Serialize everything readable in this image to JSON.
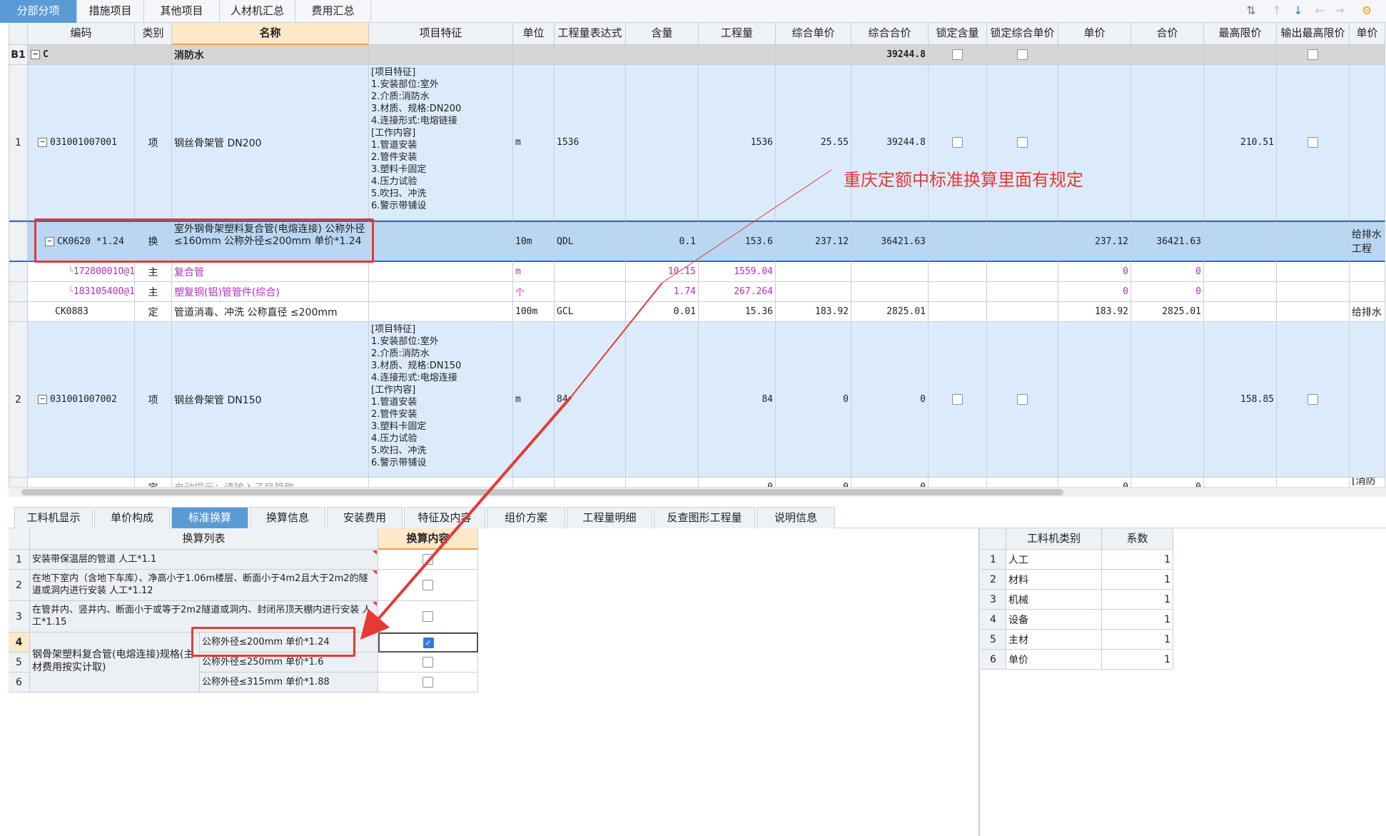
{
  "top_tabs": [
    "分部分项",
    "措施项目",
    "其他项目",
    "人材机汇总",
    "费用汇总"
  ],
  "toolbar_icons": [
    "sort-icon",
    "arrow-up-icon",
    "arrow-down-icon",
    "arrow-left-icon",
    "arrow-right-icon",
    "settings-icon"
  ],
  "columns": [
    "编码",
    "类别",
    "名称",
    "项目特征",
    "单位",
    "工程量表达式",
    "含量",
    "工程量",
    "综合单价",
    "综合合价",
    "锁定含量",
    "锁定综合单价",
    "单价",
    "合价",
    "最高限价",
    "输出最高限价",
    "单价构"
  ],
  "rows": [
    {
      "idx": "B1",
      "code": "C",
      "type": "",
      "name": "消防水",
      "feature": "",
      "unit": "",
      "expr": "",
      "content": "",
      "qty": "",
      "uprice": "",
      "total": "39244.8",
      "lock_content": true,
      "lock_uprice": true,
      "price": "",
      "sum": "",
      "max_price": "",
      "out_max": true,
      "price_comp": ""
    },
    {
      "idx": "1",
      "code": "031001007001",
      "type": "项",
      "name": "钢丝骨架管 DN200",
      "feature": "[项目特征]\n1.安装部位:室外\n2.介质:消防水\n3.材质、规格:DN200\n4.连接形式:电熔链接\n[工作内容]\n1.管道安装\n2.管件安装\n3.塑料卡固定\n4.压力试验\n5.吹扫、冲洗\n6.警示带铺设",
      "unit": "m",
      "expr": "1536",
      "content": "",
      "qty": "1536",
      "uprice": "25.55",
      "total": "39244.8",
      "lock_content": true,
      "lock_uprice": true,
      "price": "",
      "sum": "",
      "max_price": "210.51",
      "out_max": true,
      "price_comp": ""
    },
    {
      "idx": "",
      "code": "CK0620 *1.24",
      "type": "换",
      "name": "室外钢骨架塑料复合管(电熔连接) 公称外径 ≤160mm 公称外径≤200mm 单价*1.24",
      "feature": "",
      "unit": "10m",
      "expr": "QDL",
      "content": "0.1",
      "qty": "153.6",
      "uprice": "237.12",
      "total": "36421.63",
      "lock_content": false,
      "lock_uprice": false,
      "price": "237.12",
      "sum": "36421.63",
      "max_price": "",
      "out_max": false,
      "price_comp": "给排水工程"
    },
    {
      "idx": "",
      "code": "17280001O@1",
      "type": "主",
      "name": "复合管",
      "feature": "",
      "unit": "m",
      "expr": "",
      "content": "10.15",
      "qty": "1559.04",
      "uprice": "",
      "total": "",
      "lock_content": false,
      "lock_uprice": false,
      "price": "0",
      "sum": "0",
      "max_price": "",
      "out_max": false,
      "price_comp": ""
    },
    {
      "idx": "",
      "code": "18310540O@1",
      "type": "主",
      "name": "塑复铜(铝)管管件(综合)",
      "feature": "",
      "unit": "个",
      "expr": "",
      "content": "1.74",
      "qty": "267.264",
      "uprice": "",
      "total": "",
      "lock_content": false,
      "lock_uprice": false,
      "price": "0",
      "sum": "0",
      "max_price": "",
      "out_max": false,
      "price_comp": ""
    },
    {
      "idx": "",
      "code": "CK0883",
      "type": "定",
      "name": "管道消毒、冲洗 公称直径 ≤200mm",
      "feature": "",
      "unit": "100m",
      "expr": "GCL",
      "content": "0.01",
      "qty": "15.36",
      "uprice": "183.92",
      "total": "2825.01",
      "lock_content": false,
      "lock_uprice": false,
      "price": "183.92",
      "sum": "2825.01",
      "max_price": "",
      "out_max": false,
      "price_comp": "给排水"
    },
    {
      "idx": "2",
      "code": "031001007002",
      "type": "项",
      "name": "钢丝骨架管 DN150",
      "feature": "[项目特征]\n1.安装部位:室外\n2.介质:消防水\n3.材质、规格:DN150\n4.连接形式:电熔连接\n[工作内容]\n1.管道安装\n2.管件安装\n3.塑料卡固定\n4.压力试验\n5.吹扫、冲洗\n6.警示带铺设",
      "unit": "m",
      "expr": "84",
      "content": "",
      "qty": "84",
      "uprice": "0",
      "total": "0",
      "lock_content": true,
      "lock_uprice": true,
      "price": "",
      "sum": "",
      "max_price": "158.85",
      "out_max": true,
      "price_comp": ""
    },
    {
      "idx": "",
      "code": "",
      "type": "定",
      "name": "自动提示：请输入子目简称",
      "feature": "",
      "unit": "",
      "expr": "",
      "content": "",
      "qty": "0",
      "uprice": "0",
      "total": "0",
      "lock_content": false,
      "lock_uprice": false,
      "price": "0",
      "sum": "0",
      "max_price": "",
      "out_max": false,
      "price_comp": "[消防工"
    }
  ],
  "annotation": "重庆定额中标准换算里面有规定",
  "bottom_tabs": [
    "工料机显示",
    "单价构成",
    "标准换算",
    "换算信息",
    "安装费用",
    "特征及内容",
    "组价方案",
    "工程量明细",
    "反查图形工程量",
    "说明信息"
  ],
  "conv_headers": [
    "换算列表",
    "换算内容"
  ],
  "conv_rows": [
    {
      "idx": "1",
      "text": "安装带保温层的管道 人工*1.1",
      "checked": false
    },
    {
      "idx": "2",
      "text": "在地下室内（含地下车库）、净高小于1.06m楼层、断面小于4m2且大于2m2的隧道或洞内进行安装 人工*1.12",
      "checked": false
    },
    {
      "idx": "3",
      "text": "在管井内、竖井内、断面小于或等于2m2隧道或洞内、封闭吊顶天棚内进行安装 人工*1.15",
      "checked": false
    },
    {
      "idx": "4",
      "text": "公称外径≤200mm 单价*1.24",
      "checked": true
    },
    {
      "idx": "5",
      "text": "公称外径≤250mm 单价*1.6",
      "checked": false
    },
    {
      "idx": "6",
      "text": "公称外径≤315mm 单价*1.88",
      "checked": false
    }
  ],
  "conv_group_label": "钢骨架塑料复合管(电熔连接)规格(主材费用按实计取)",
  "coef_headers": [
    "工料机类别",
    "系数"
  ],
  "coef_rows": [
    {
      "idx": "1",
      "cat": "人工",
      "val": "1"
    },
    {
      "idx": "2",
      "cat": "材料",
      "val": "1"
    },
    {
      "idx": "3",
      "cat": "机械",
      "val": "1"
    },
    {
      "idx": "4",
      "cat": "设备",
      "val": "1"
    },
    {
      "idx": "5",
      "cat": "主材",
      "val": "1"
    },
    {
      "idx": "6",
      "cat": "单价",
      "val": "1"
    }
  ],
  "colors": {
    "accent": "#5b9bd5",
    "selected_row": "#b9d6f2",
    "item_row": "#dcebfb",
    "highlight": "#e53935"
  }
}
